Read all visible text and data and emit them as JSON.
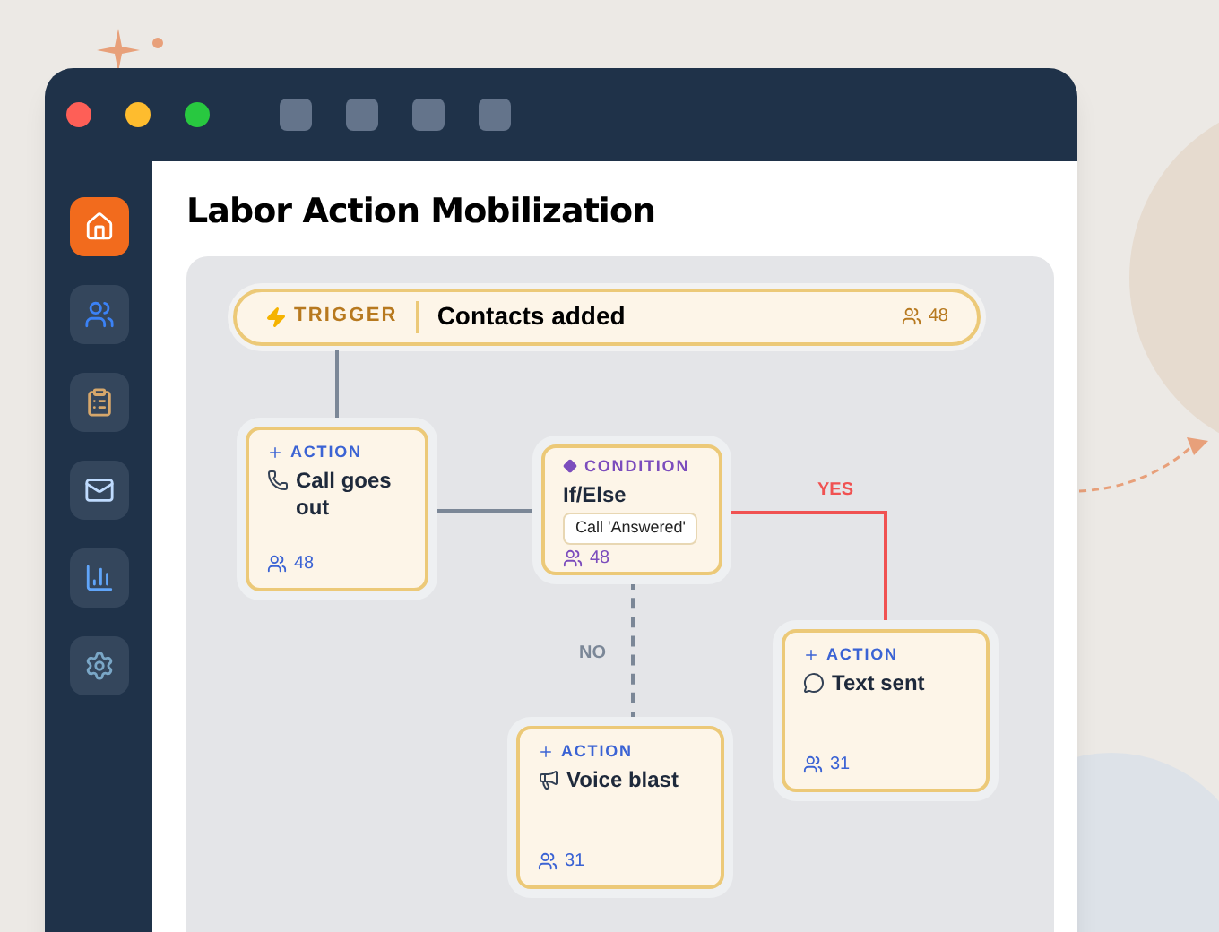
{
  "window": {
    "title": "Labor Action Mobilization"
  },
  "sidebar": {
    "items": [
      {
        "kind": "home",
        "selected": true
      },
      {
        "kind": "people",
        "selected": false
      },
      {
        "kind": "clipboard",
        "selected": false
      },
      {
        "kind": "mail",
        "selected": false
      },
      {
        "kind": "chart",
        "selected": false
      },
      {
        "kind": "settings",
        "selected": false
      }
    ]
  },
  "flow": {
    "trigger": {
      "tag": "TRIGGER",
      "title": "Contacts added",
      "count": "48"
    },
    "nodes": [
      {
        "kind": "action",
        "tag": "ACTION",
        "title": "Call goes out",
        "count": "48"
      },
      {
        "kind": "condition",
        "tag": "CONDITION",
        "title": "If/Else",
        "rule": "Call 'Answered'",
        "count": "48"
      },
      {
        "kind": "action",
        "tag": "ACTION",
        "title": "Text sent",
        "count": "31"
      },
      {
        "kind": "action",
        "tag": "ACTION",
        "title": "Voice blast",
        "count": "31"
      }
    ],
    "branches": [
      {
        "kind": "yes",
        "label": "YES"
      },
      {
        "kind": "no",
        "label": "NO"
      }
    ]
  }
}
